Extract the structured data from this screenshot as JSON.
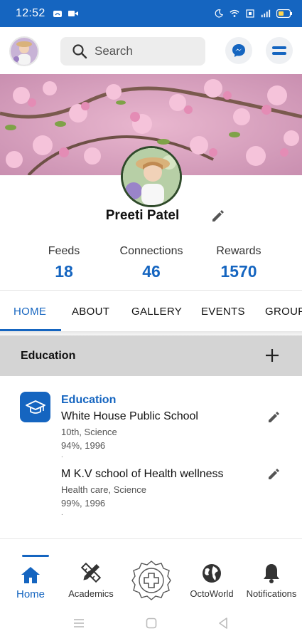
{
  "status_bar": {
    "time": "12:52",
    "icons": [
      "cloud-icon",
      "video-icon",
      "moon-icon",
      "wifi-icon",
      "lte-icon",
      "signal-icon",
      "battery-icon"
    ]
  },
  "header": {
    "search_placeholder": "Search",
    "icons": [
      "profile-avatar",
      "search-icon",
      "messenger-icon",
      "menu-icon"
    ]
  },
  "profile": {
    "name": "Preeti Patel",
    "stats": [
      {
        "label": "Feeds",
        "value": "18"
      },
      {
        "label": "Connections",
        "value": "46"
      },
      {
        "label": "Rewards",
        "value": "1570"
      }
    ]
  },
  "tabs": [
    {
      "label": "HOME",
      "active": true
    },
    {
      "label": "ABOUT",
      "active": false
    },
    {
      "label": "GALLERY",
      "active": false
    },
    {
      "label": "EVENTS",
      "active": false
    },
    {
      "label": "GROUP",
      "active": false
    }
  ],
  "education": {
    "section_title": "Education",
    "heading": "Education",
    "entries": [
      {
        "school": "White House Public School",
        "detail": "10th, Science",
        "result": "94%, 1996",
        "marker": "."
      },
      {
        "school": "M K.V school of Health wellness",
        "detail": "Health care, Science",
        "result": "99%, 1996",
        "marker": "."
      }
    ]
  },
  "bottom_nav": [
    {
      "label": "Home",
      "icon": "home-icon",
      "active": true
    },
    {
      "label": "Academics",
      "icon": "academics-icon",
      "active": false
    },
    {
      "label": "",
      "icon": "add-post-icon",
      "active": false
    },
    {
      "label": "OctoWorld",
      "icon": "globe-icon",
      "active": false
    },
    {
      "label": "Notifications",
      "icon": "bell-icon",
      "active": false
    }
  ],
  "colors": {
    "primary": "#1565c0",
    "section_bg": "#d4d4d4",
    "text": "#111111"
  }
}
